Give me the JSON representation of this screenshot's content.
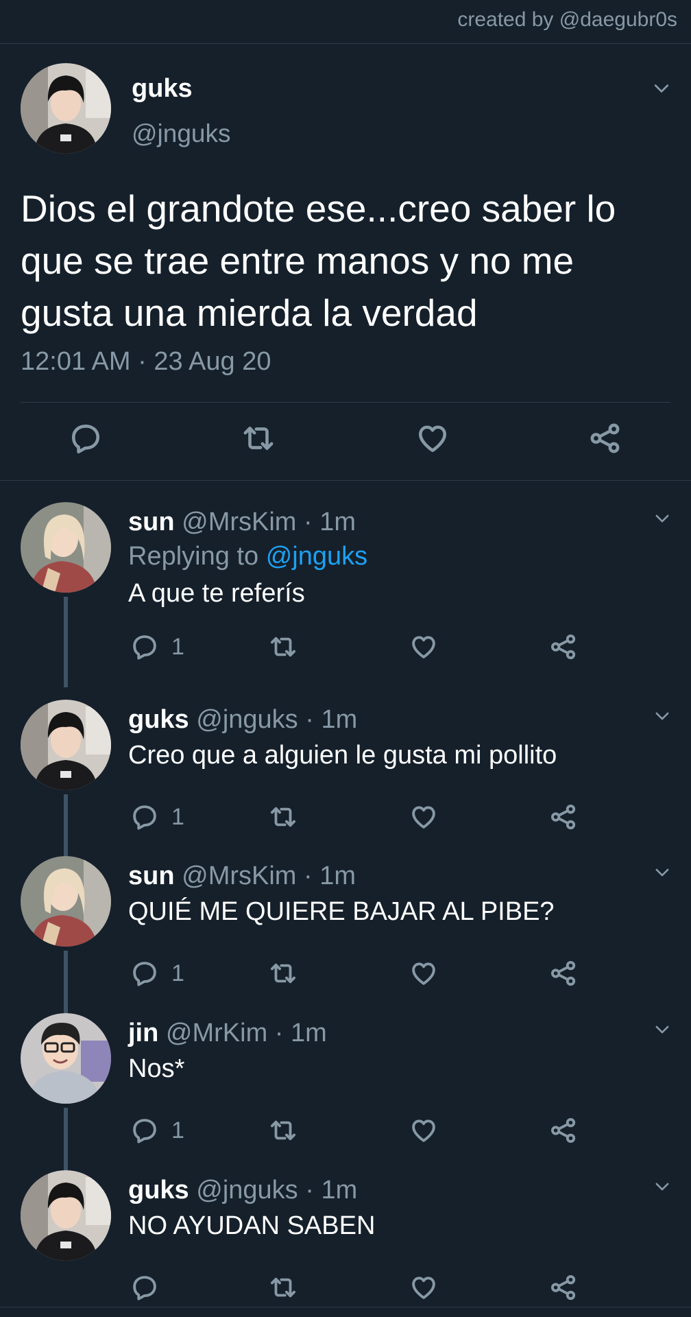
{
  "watermark": "created by @daegubr0s",
  "main_tweet": {
    "name": "guks",
    "handle": "@jnguks",
    "text": "Dios el grandote ese...creo saber lo que se trae entre manos y no me gusta una mierda la verdad",
    "timestamp": "12:01 AM · 23 Aug 20",
    "actions": [
      "reply-icon",
      "retweet-icon",
      "like-icon",
      "share-icon"
    ]
  },
  "replies": [
    {
      "name": "sun",
      "handle": "@MrsKim · 1m",
      "replying_label": "Replying to",
      "replying_to": "@jnguks",
      "text": "A que te referís",
      "reply_count": "1",
      "avatar": "girl-blonde"
    },
    {
      "name": "guks",
      "handle": "@jnguks · 1m",
      "text": "Creo que a alguien le gusta mi pollito",
      "reply_count": "1",
      "avatar": "boy-dark"
    },
    {
      "name": "sun",
      "handle": "@MrsKim · 1m",
      "text": "QUIÉ ME QUIERE BAJAR AL PIBE?",
      "reply_count": "1",
      "avatar": "girl-blonde"
    },
    {
      "name": "jin",
      "handle": "@MrKim · 1m",
      "text": "Nos*",
      "reply_count": "1",
      "avatar": "boy-glasses"
    },
    {
      "name": "guks",
      "handle": "@jnguks · 1m",
      "text": "NO AYUDAN SABEN",
      "reply_count": "",
      "avatar": "boy-dark"
    }
  ],
  "colors": {
    "background": "#15202b",
    "secondary_text": "#8899a6",
    "link": "#1da1f2",
    "thread_line": "#3d5466"
  }
}
